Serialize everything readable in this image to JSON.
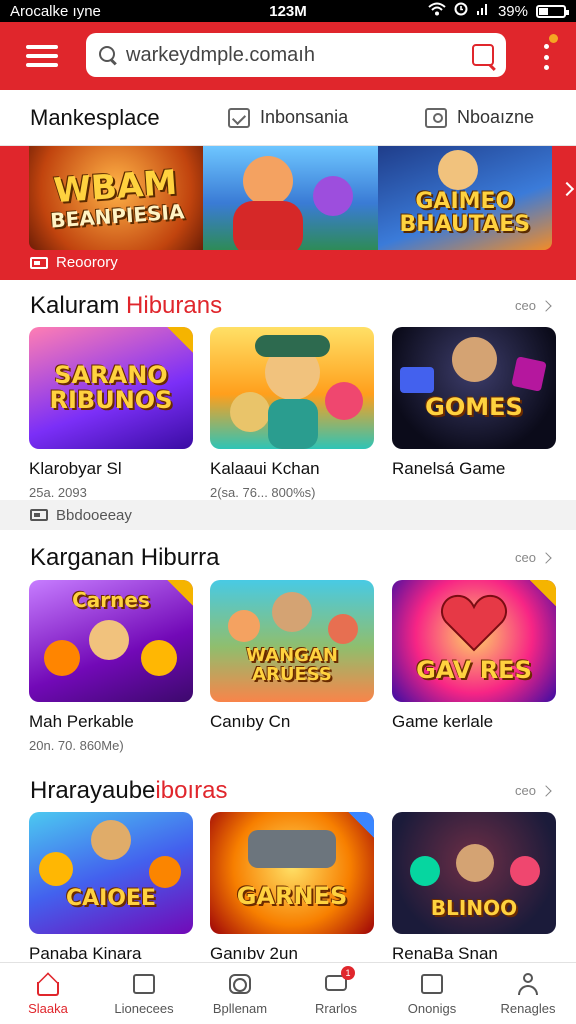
{
  "status_bar": {
    "carrier": "Arocalke ıyne",
    "time": "123M",
    "battery": "39%",
    "battery_level": 0.39
  },
  "header": {
    "search_value": "warkeydmple.comaıh",
    "search_placeholder": "warkeydmple.comaıh"
  },
  "tabs": [
    {
      "label": "Mankesplace",
      "icon": "none"
    },
    {
      "label": "Inbonsania",
      "icon": "checkbox-icon"
    },
    {
      "label": "Nboaızne",
      "icon": "person-card-icon"
    }
  ],
  "banner": {
    "tiles": [
      {
        "title": "WBAM",
        "subtitle": "BEANPIESIA"
      },
      {
        "title": "",
        "subtitle": ""
      },
      {
        "title": "GAIMEO",
        "subtitle": "BHAUTAES"
      }
    ],
    "label": "Reoorory"
  },
  "sections": [
    {
      "title_main": "Kaluram",
      "title_accent": "Hiburans",
      "see_more": "ceo",
      "cards": [
        {
          "thumb_text": "SARANO RIBUNOS",
          "title": "Klarobyar Sl",
          "meta": "25a. 2093"
        },
        {
          "thumb_text": "",
          "title": "Kalaaui Kchan",
          "meta": "2(sa. 76... 800%s)"
        },
        {
          "thumb_text": "GOMES",
          "title": "Ranelsá Game",
          "meta": ""
        }
      ]
    },
    {
      "title_main": "Karganan Hiburra",
      "title_accent": "",
      "see_more": "ceo",
      "cards": [
        {
          "thumb_text": "Carnes",
          "title": "Mah Perkable",
          "meta": "20n. 70. 860Me)"
        },
        {
          "thumb_text": "WANGAN ARUESS",
          "title": "Canıby Cn",
          "meta": ""
        },
        {
          "thumb_text": "GAV RES",
          "title": "Game kerlale",
          "meta": ""
        }
      ]
    },
    {
      "title_main": "Hrarayaube",
      "title_accent": "iboıras",
      "see_more": "ceo",
      "cards": [
        {
          "thumb_text": "CAIOEE",
          "title": "Panaba Kinara",
          "meta": ""
        },
        {
          "thumb_text": "GARNES",
          "title": "Ganıbv 2un",
          "meta": ""
        },
        {
          "thumb_text": "BLINOO",
          "title": "RenaBa Snan",
          "meta": ""
        }
      ]
    }
  ],
  "divider": {
    "label": "Bbdooeeay"
  },
  "bottom_nav": [
    {
      "label": "Slaaka",
      "icon": "home-icon",
      "active": true
    },
    {
      "label": "Lionecees",
      "icon": "gallery-icon",
      "active": false
    },
    {
      "label": "Bpllenam",
      "icon": "camera-icon",
      "active": false
    },
    {
      "label": "Rrarlos",
      "icon": "chat-icon",
      "active": false,
      "badge": "1"
    },
    {
      "label": "Ononigs",
      "icon": "inbox-icon",
      "active": false
    },
    {
      "label": "Renagles",
      "icon": "profile-icon",
      "active": false
    }
  ],
  "colors": {
    "brand_red": "#e0262c",
    "accent_gold": "#ffd23f"
  }
}
